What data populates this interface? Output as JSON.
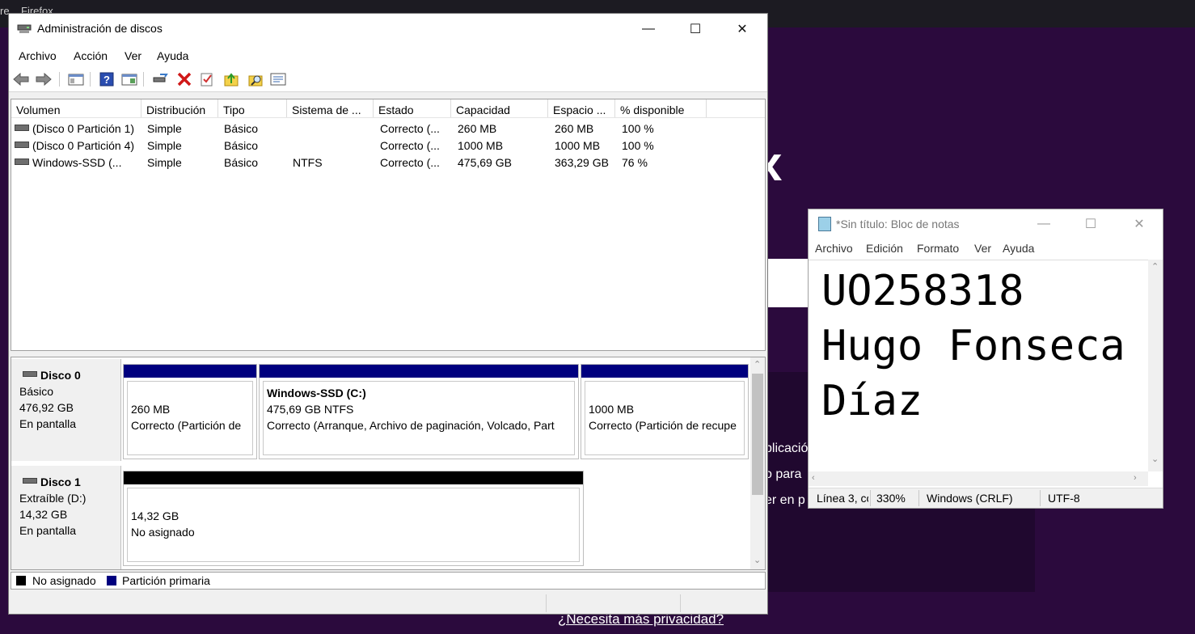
{
  "background": {
    "browser_tab_text": "re... Firefox",
    "private_line1": "plicació",
    "private_line2": "o para",
    "private_line3": "er en p",
    "privacy_link": "¿Necesita más privacidad?"
  },
  "disk_mgmt": {
    "title": "Administración de discos",
    "menu": [
      "Archivo",
      "Acción",
      "Ver",
      "Ayuda"
    ],
    "toolbar": [
      "back-icon",
      "forward-icon",
      "console-tree-icon",
      "help-icon",
      "properties-icon",
      "connect-icon",
      "delete-icon",
      "check-icon",
      "folder-up-icon",
      "search-folder-icon",
      "settings-list-icon"
    ],
    "columns": [
      "Volumen",
      "Distribución",
      "Tipo",
      "Sistema de ...",
      "Estado",
      "Capacidad",
      "Espacio ...",
      "% disponible"
    ],
    "volumes": [
      {
        "name": "(Disco 0 Partición 1)",
        "layout": "Simple",
        "type": "Básico",
        "fs": "",
        "status": "Correcto (...",
        "capacity": "260 MB",
        "free": "260 MB",
        "pct": "100 %"
      },
      {
        "name": "(Disco 0 Partición 4)",
        "layout": "Simple",
        "type": "Básico",
        "fs": "",
        "status": "Correcto (...",
        "capacity": "1000 MB",
        "free": "1000 MB",
        "pct": "100 %"
      },
      {
        "name": "Windows-SSD (...",
        "layout": "Simple",
        "type": "Básico",
        "fs": "NTFS",
        "status": "Correcto (...",
        "capacity": "475,69 GB",
        "free": "363,29 GB",
        "pct": "76 %"
      }
    ],
    "disks": [
      {
        "name": "Disco 0",
        "kind": "Básico",
        "size": "476,92 GB",
        "state": "En pantalla",
        "partitions": [
          {
            "title": "",
            "line1": "260 MB",
            "line2": "Correcto (Partición de"
          },
          {
            "title": "Windows-SSD  (C:)",
            "line1": "475,69 GB NTFS",
            "line2": "Correcto (Arranque, Archivo de paginación, Volcado, Part"
          },
          {
            "title": "",
            "line1": "1000 MB",
            "line2": "Correcto (Partición de recupe"
          }
        ]
      },
      {
        "name": "Disco 1",
        "kind": "Extraíble (D:)",
        "size": "14,32 GB",
        "state": "En pantalla",
        "partitions": [
          {
            "title": "",
            "line1": "14,32 GB",
            "line2": "No asignado"
          }
        ]
      }
    ],
    "legend": [
      "No asignado",
      "Partición primaria"
    ],
    "colors": {
      "unallocated": "#000000",
      "primary": "#00007f"
    }
  },
  "notepad": {
    "title": "*Sin título: Bloc de notas",
    "menu": [
      "Archivo",
      "Edición",
      "Formato",
      "Ver",
      "Ayuda"
    ],
    "content": "UO258318\nHugo Fonseca\nDíaz",
    "status": {
      "position": "Línea 3, co",
      "zoom": "330%",
      "eol": "Windows (CRLF)",
      "encoding": "UTF-8"
    }
  }
}
